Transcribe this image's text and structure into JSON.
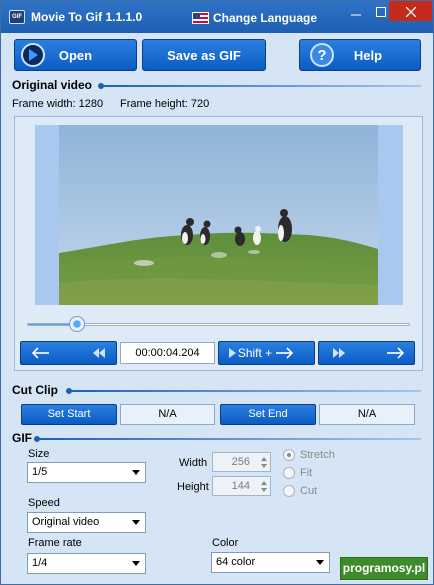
{
  "titlebar": {
    "title": "Movie To Gif 1.1.1.0",
    "language_label": "Change Language",
    "app_icon_text": "GIF"
  },
  "toolbar": {
    "open_label": "Open",
    "save_label": "Save as GIF",
    "help_label": "Help"
  },
  "original_video": {
    "heading": "Original video",
    "frame_width_text": "Frame width: 1280",
    "frame_height_text": "Frame height: 720",
    "slider_fraction": 0.13,
    "time": "00:00:04.204",
    "shift_label": "Shift +"
  },
  "cut_clip": {
    "heading": "Cut Clip",
    "start_label": "Set Start",
    "start_value": "N/A",
    "end_label": "Set End",
    "end_value": "N/A"
  },
  "gif": {
    "heading": "GIF",
    "size_label": "Size",
    "size_value": "1/5",
    "speed_label": "Speed",
    "speed_value": "Original video",
    "framerate_label": "Frame rate",
    "framerate_value": "1/4",
    "width_label": "Width",
    "width_value": "256",
    "height_label": "Height",
    "height_value": "144",
    "radio_stretch": "Stretch",
    "radio_fit": "Fit",
    "radio_cut": "Cut",
    "color_label": "Color",
    "color_value": "64 color"
  },
  "watermark": {
    "text": "programosy.pl"
  },
  "colors": {
    "accent": "#0b5cc4",
    "titlebar": "#1e5fb0",
    "close": "#c42b1c",
    "background": "#d6e5f5"
  }
}
